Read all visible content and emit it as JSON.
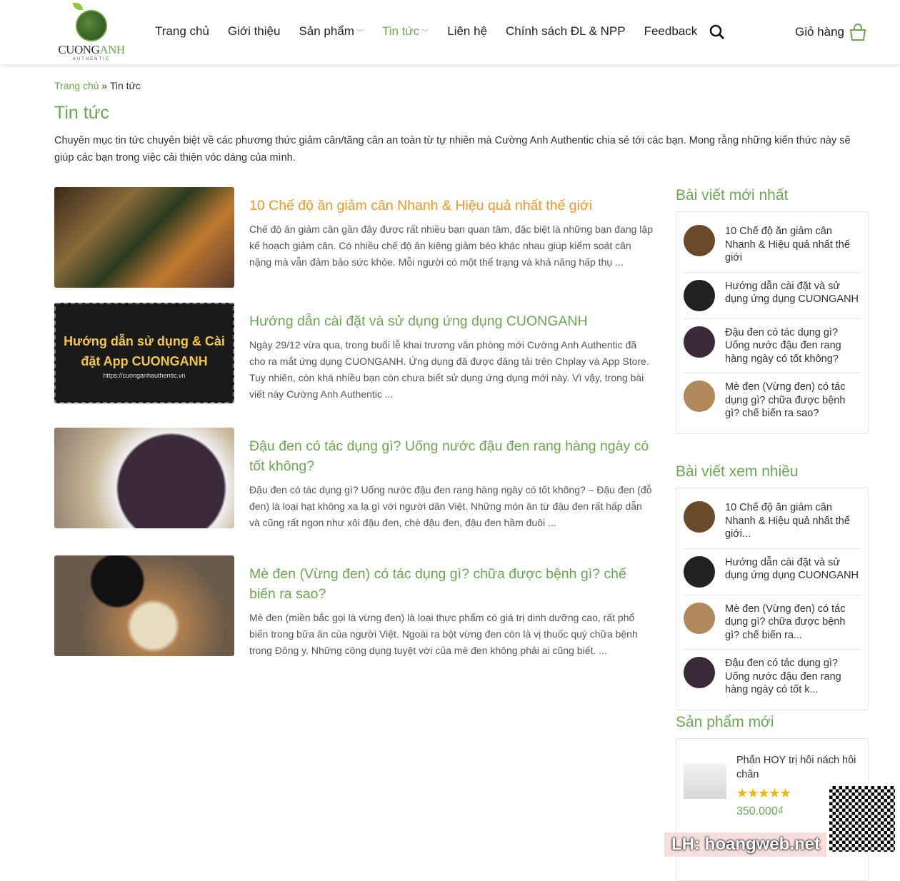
{
  "logo": {
    "brand_a": "CUONG",
    "brand_b": "ANH",
    "sub": "AUTHENTIC"
  },
  "nav": [
    {
      "label": "Trang chủ"
    },
    {
      "label": "Giới thiệu"
    },
    {
      "label": "Sản phẩm"
    },
    {
      "label": "Tin tức"
    },
    {
      "label": "Liên hệ"
    },
    {
      "label": "Chính sách ĐL & NPP"
    },
    {
      "label": "Feedback"
    }
  ],
  "cart_label": "Giỏ hàng",
  "breadcrumb": {
    "home": "Trang chủ",
    "sep": "»",
    "current": "Tin tức"
  },
  "page_title": "Tin tức",
  "intro": "Chuyên mục tin tức chuyên biệt về các phương thức giảm cân/tăng cân an toàn từ tự nhiên mà Cường Anh Authentic chia sẻ tới các bạn. Mong rằng những kiến thức này sẽ giúp các bạn trong việc cải thiện vóc dáng của mình.",
  "posts": [
    {
      "title": "10 Chế độ ăn giảm cân Nhanh & Hiệu quả nhất thế giới",
      "excerpt": "Chế độ ăn giảm cân gần đây được rất nhiều bạn quan tâm, đặc biệt là những bạn đang lập kế hoạch giảm cân. Có nhiều chế độ ăn kiêng giảm béo khác nhau giúp kiểm soát cân nặng mà vẫn đảm bảo sức khỏe. Mỗi người có một thể trạng và khả năng hấp thụ ..."
    },
    {
      "title": "Hướng dẫn cài đặt và sử dụng ứng dụng CUONGANH",
      "excerpt": "Ngày 29/12 vừa qua, trong buổi lễ khai trương văn phòng mới Cường Anh Authentic đã cho ra mắt ứng dụng CUONGANH. Ứng dụng đã được đăng tải trên Chplay và App Store. Tuy nhiên, còn khá nhiều bạn còn chưa biết sử dụng ứng dụng mới này. Vì vậy, trong bài viết này Cường Anh Authentic ...",
      "thumb_text": "Hướng dẫn sử dụng & Cài đặt App CUONGANH",
      "thumb_url": "https://cuonganhauthentic.vn"
    },
    {
      "title": "Đậu đen có tác dụng gì? Uống nước đậu đen rang hàng ngày có tốt không?",
      "excerpt": "Đậu đen có tác dụng gì? Uống nước đậu đen rang hàng ngày có tốt không? – Đậu đen (đỗ đen) là loại hạt không xa lạ gì với người dân Việt. Những món ăn từ đậu đen rất hấp dẫn và cũng rất ngon như xôi đậu đen, chè đậu đen, đậu đen hầm đuôi ..."
    },
    {
      "title": "Mè đen (Vừng đen) có tác dụng gì? chữa được bệnh gì? chế biến ra sao?",
      "excerpt": "Mè đen (miền bắc gọi là vừng đen) là loại thực phẩm có giá trị dinh dưỡng cao, rất phổ biến trong bữa ăn của người Việt. Ngoài ra bột vừng đen còn là vị thuốc quý chữa bệnh trong Đông y. Những công dụng tuyệt vời của mè đen không phải ai cũng biết. ..."
    }
  ],
  "sidebar": {
    "latest_title": "Bài viết mới nhất",
    "latest": [
      "10 Chế độ ăn giảm cân Nhanh & Hiệu quả nhất thế giới",
      "Hướng dẫn cài đặt và sử dụng ứng dụng CUONGANH",
      "Đậu đen có tác dụng gì? Uống nước đậu đen rang hàng ngày có tốt không?",
      "Mè đen (Vừng đen) có tác dụng gì? chữa được bệnh gì? chế biến ra sao?"
    ],
    "popular_title": "Bài viết xem nhiều",
    "popular": [
      "10 Chế độ ăn giảm cân Nhanh & Hiệu quả nhất thế giới...",
      "Hướng dẫn cài đặt và sử dụng ứng dụng CUONGANH",
      "Mè đen (Vừng đen) có tác dụng gì? chữa được bệnh gì? chế biến ra...",
      "Đậu đen có tác dụng gì? Uống nước đậu đen rang hàng ngày có tốt k..."
    ],
    "products_title": "Sản phẩm mới",
    "product": {
      "name": "Phấn HOY trị hôi nách hôi chân",
      "rating": 5,
      "stars": "★★★★★",
      "price": "350.000₫"
    }
  },
  "watermark": "LH: hoangweb.net",
  "colors": {
    "accent": "#6aa84f",
    "highlight": "#f7931e"
  }
}
